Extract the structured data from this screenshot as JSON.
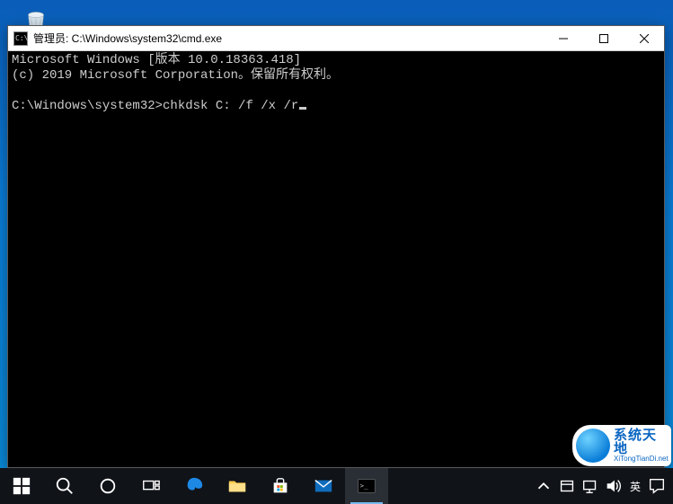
{
  "window": {
    "title": "管理员: C:\\Windows\\system32\\cmd.exe"
  },
  "terminal": {
    "line1": "Microsoft Windows [版本 10.0.18363.418]",
    "line2": "(c) 2019 Microsoft Corporation。保留所有权利。",
    "blank": "",
    "prompt": "C:\\Windows\\system32>",
    "command": "chkdsk C: /f /x /r"
  },
  "tray": {
    "ime": "英"
  },
  "watermark": {
    "title": "系统天地",
    "sub": "XiTongTianDi.net"
  }
}
